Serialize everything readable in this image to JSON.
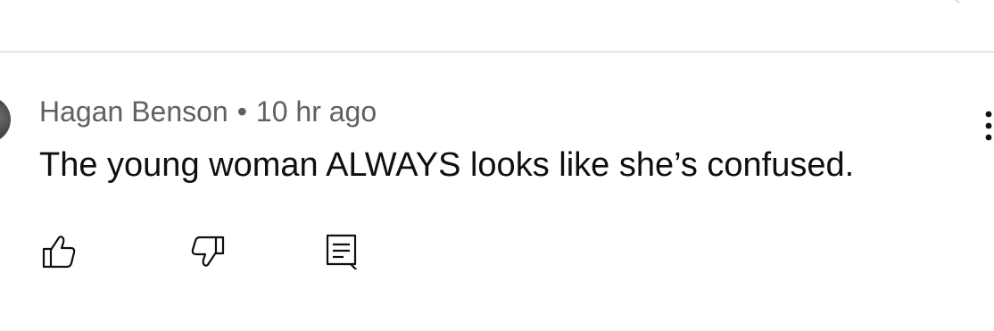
{
  "comment": {
    "author": "Hagan Benson",
    "separator": "•",
    "timestamp": "10 hr ago",
    "text": "The young woman ALWAYS looks like she’s confused."
  },
  "actions": {
    "like_icon": "thumbs-up-icon",
    "dislike_icon": "thumbs-down-icon",
    "reply_icon": "reply-comment-icon",
    "more_icon": "more-vertical-icon"
  },
  "colors": {
    "text_primary": "#0f0f0f",
    "text_secondary": "#606060",
    "divider": "#e3e3e3",
    "background": "#ffffff"
  }
}
